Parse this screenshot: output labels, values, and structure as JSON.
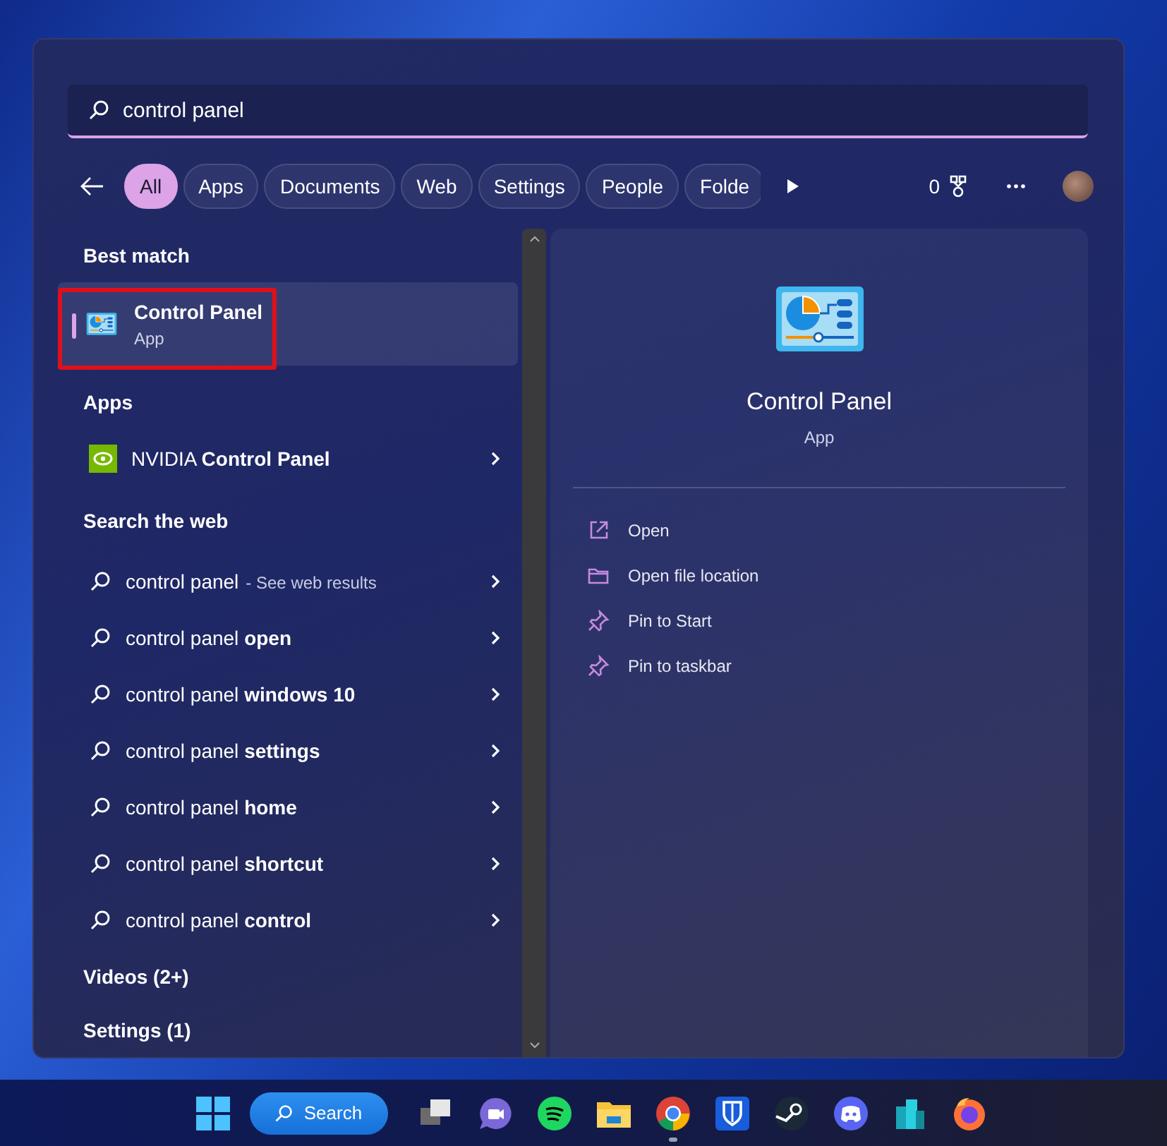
{
  "search": {
    "value": "control panel"
  },
  "filters": [
    {
      "label": "All",
      "selected": true
    },
    {
      "label": "Apps",
      "selected": false
    },
    {
      "label": "Documents",
      "selected": false
    },
    {
      "label": "Web",
      "selected": false
    },
    {
      "label": "Settings",
      "selected": false
    },
    {
      "label": "People",
      "selected": false
    },
    {
      "label": "Folde",
      "selected": false
    }
  ],
  "rewards": {
    "count": "0"
  },
  "best_match": {
    "heading": "Best match",
    "name": "Control Panel",
    "type": "App",
    "selected": true,
    "highlighted": true
  },
  "apps": {
    "heading": "Apps",
    "items": [
      {
        "name": "NVIDIA **Control Panel**"
      }
    ]
  },
  "web": {
    "heading": "Search the web",
    "items": [
      {
        "text": "control panel",
        "suffix": "- See web results"
      },
      {
        "text": "control panel **open**"
      },
      {
        "text": "control panel **windows 10**"
      },
      {
        "text": "control panel **settings**"
      },
      {
        "text": "control panel **home**"
      },
      {
        "text": "control panel **shortcut**"
      },
      {
        "text": "control panel **control**"
      }
    ]
  },
  "more_sections": [
    "Videos (2+)",
    "Settings (1)"
  ],
  "detail": {
    "title": "Control Panel",
    "subtitle": "App",
    "actions": [
      {
        "label": "Open",
        "kind": "open"
      },
      {
        "label": "Open file location",
        "kind": "folder"
      },
      {
        "label": "Pin to Start",
        "kind": "pin"
      },
      {
        "label": "Pin to taskbar",
        "kind": "pin"
      }
    ]
  },
  "taskbar": {
    "search_label": "Search",
    "apps": [
      {
        "kind": "task-view",
        "running": false
      },
      {
        "kind": "video-chat",
        "running": false
      },
      {
        "kind": "music",
        "running": false
      },
      {
        "kind": "folder",
        "running": false
      },
      {
        "kind": "browser",
        "running": true
      },
      {
        "kind": "shield",
        "running": false
      },
      {
        "kind": "steam",
        "running": false
      },
      {
        "kind": "chat",
        "running": false
      },
      {
        "kind": "buildings",
        "running": false
      },
      {
        "kind": "fox",
        "running": false
      }
    ]
  }
}
